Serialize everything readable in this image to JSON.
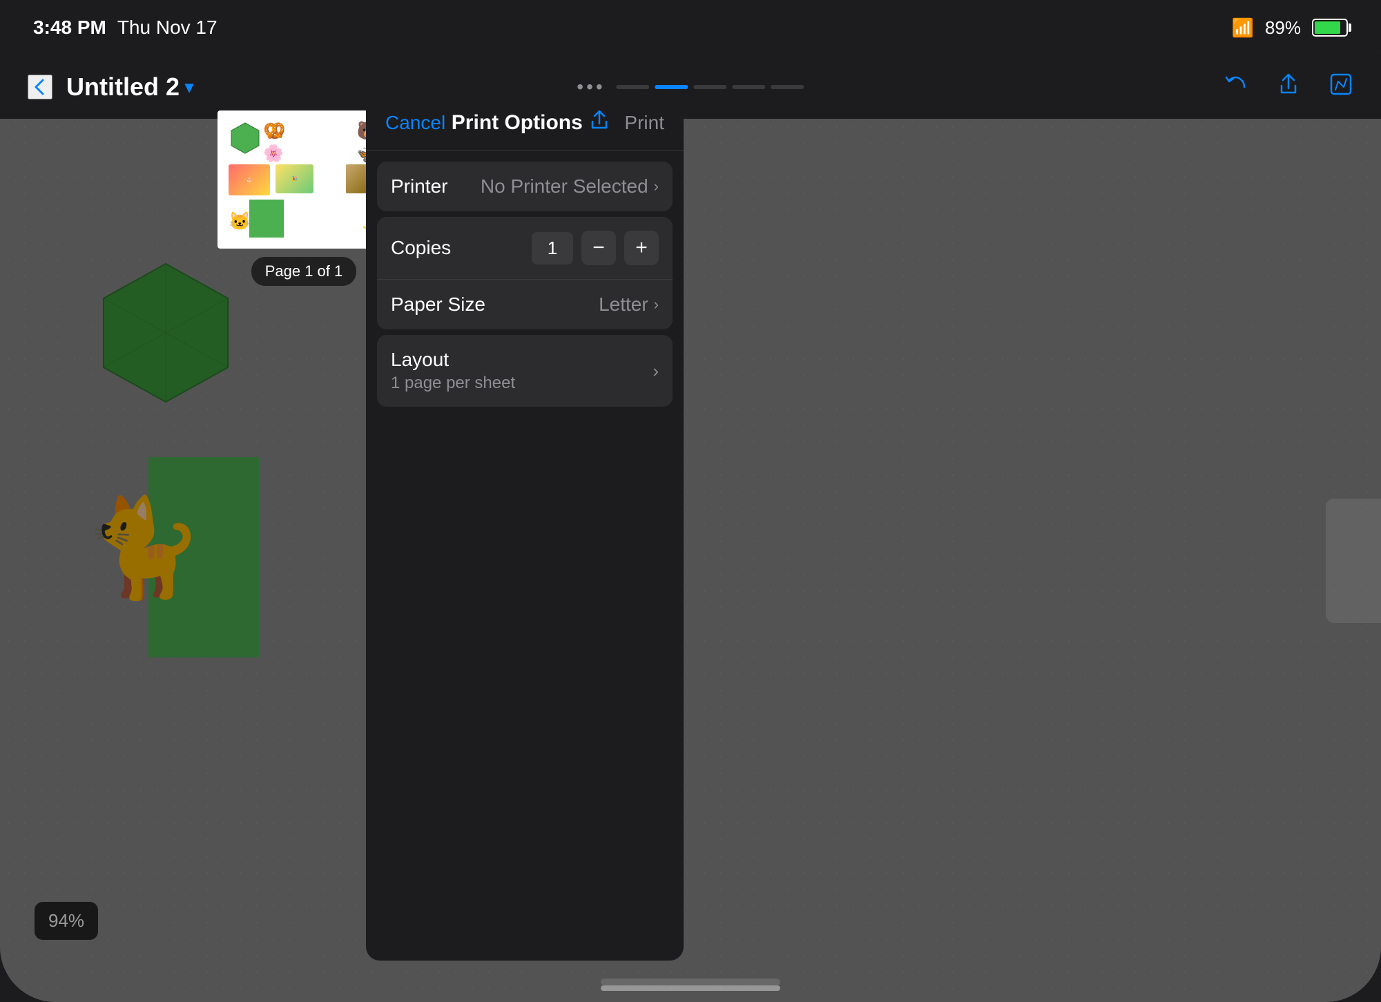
{
  "device": {
    "border_radius": "80px"
  },
  "status_bar": {
    "time": "3:48 PM",
    "date": "Thu Nov 17",
    "wifi": "⌘",
    "battery_percent": "89%"
  },
  "toolbar": {
    "back_icon": "‹",
    "doc_title": "Untitled 2",
    "doc_chevron": "▾",
    "center_dots": "•••",
    "icons": {
      "undo": "↺",
      "share": "⬆",
      "edit": "✎"
    }
  },
  "canvas": {
    "zoom_level": "94%"
  },
  "preview": {
    "page_label": "Page 1 of 1"
  },
  "print_options": {
    "title": "Print Options",
    "cancel_label": "Cancel",
    "print_label": "Print",
    "printer": {
      "label": "Printer",
      "value": "No Printer Selected"
    },
    "copies": {
      "label": "Copies",
      "value": "1"
    },
    "paper_size": {
      "label": "Paper Size",
      "value": "Letter"
    },
    "layout": {
      "label": "Layout",
      "sublabel": "1 page per sheet"
    }
  }
}
